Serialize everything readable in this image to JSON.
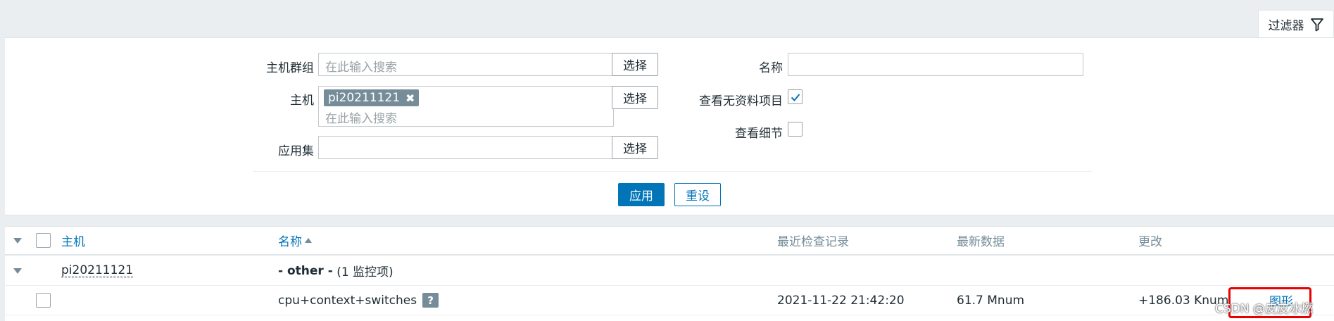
{
  "filter_tab": {
    "label": "过滤器",
    "icon": "funnel-icon"
  },
  "filter": {
    "host_group": {
      "label": "主机群组",
      "placeholder": "在此输入搜索",
      "select": "选择"
    },
    "host": {
      "label": "主机",
      "tag": "pi20211121",
      "placeholder": "在此输入搜索",
      "select": "选择"
    },
    "application": {
      "label": "应用集",
      "value": "",
      "select": "选择"
    },
    "name": {
      "label": "名称",
      "value": ""
    },
    "show_without_data": {
      "label": "查看无资料项目",
      "checked": true
    },
    "show_details": {
      "label": "查看细节",
      "checked": false
    },
    "apply": "应用",
    "reset": "重设"
  },
  "table": {
    "headers": {
      "host": "主机",
      "name": "名称",
      "last_check": "最近检查记录",
      "last_value": "最新数据",
      "change": "更改"
    },
    "group_row": {
      "host": "pi20211121",
      "group_name": "- other -",
      "group_count": "(1 监控项)"
    },
    "item_row": {
      "name": "cpu+context+switches",
      "help": "?",
      "last_check": "2021-11-22 21:42:20",
      "last_value": "61.7 Mnum",
      "change": "+186.03 Knum",
      "graph": "图形"
    }
  },
  "watermark": "CSDN @皮皮冰燃",
  "colors": {
    "accent": "#0275b8",
    "tag_bg": "#768d99",
    "highlight": "#e60000"
  }
}
